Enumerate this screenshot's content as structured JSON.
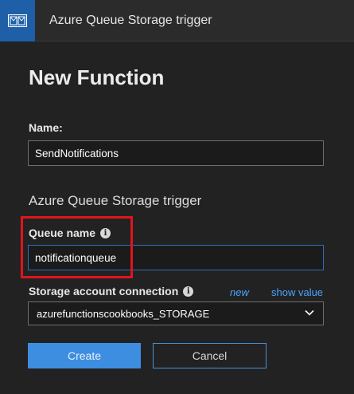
{
  "titlebar": {
    "title": "Azure Queue Storage trigger",
    "icon": "queue-envelope-icon"
  },
  "form": {
    "heading": "New Function",
    "name_label": "Name:",
    "name_value": "SendNotifications",
    "section_title": "Azure Queue Storage trigger",
    "queue_label": "Queue name",
    "queue_value": "notificationqueue",
    "conn_label": "Storage account connection",
    "new_link": "new",
    "show_value_link": "show value",
    "conn_value": "azurefunctionscookbooks_STORAGE"
  },
  "buttons": {
    "create": "Create",
    "cancel": "Cancel"
  },
  "colors": {
    "accent": "#3d8ee0",
    "highlight": "#e0141c",
    "link": "#4aa3ff"
  }
}
